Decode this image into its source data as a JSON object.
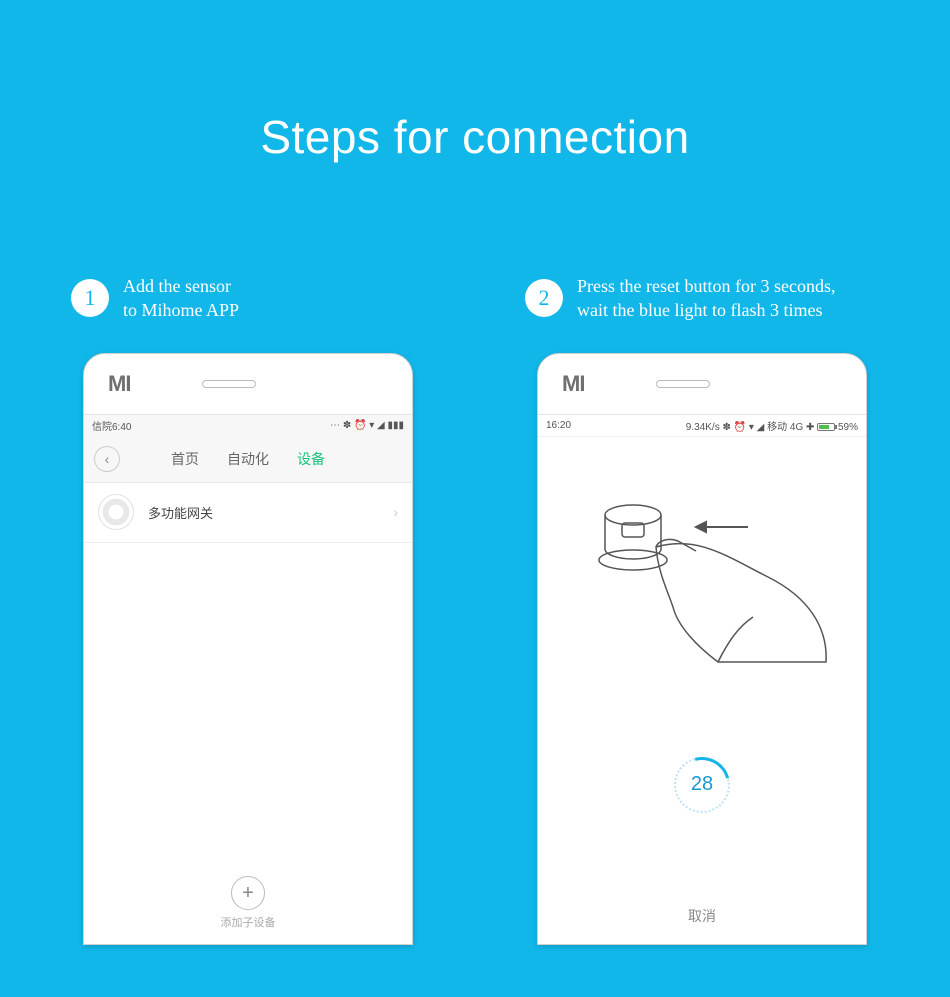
{
  "title": "Steps for connection",
  "steps": [
    {
      "num": "1",
      "text": "Add the sensor\nto Mihome APP"
    },
    {
      "num": "2",
      "text": "Press the reset button for 3 seconds,\nwait the blue light to flash 3 times"
    }
  ],
  "phone1": {
    "status_left": "信院6:40",
    "status_right": "⋯ ✽ ⏰ ▾ ◢ ▮▮▮",
    "tabs": {
      "home": "首页",
      "auto": "自动化",
      "devices": "设备"
    },
    "device_name": "多功能网关",
    "add_label": "添加子设备"
  },
  "phone2": {
    "status_left": "16:20",
    "status_right_net": "9.34K/s ✽ ⏰ ▾ ◢ 移动 4G ✚",
    "status_battery": "59%",
    "countdown": "28",
    "cancel": "取消"
  }
}
